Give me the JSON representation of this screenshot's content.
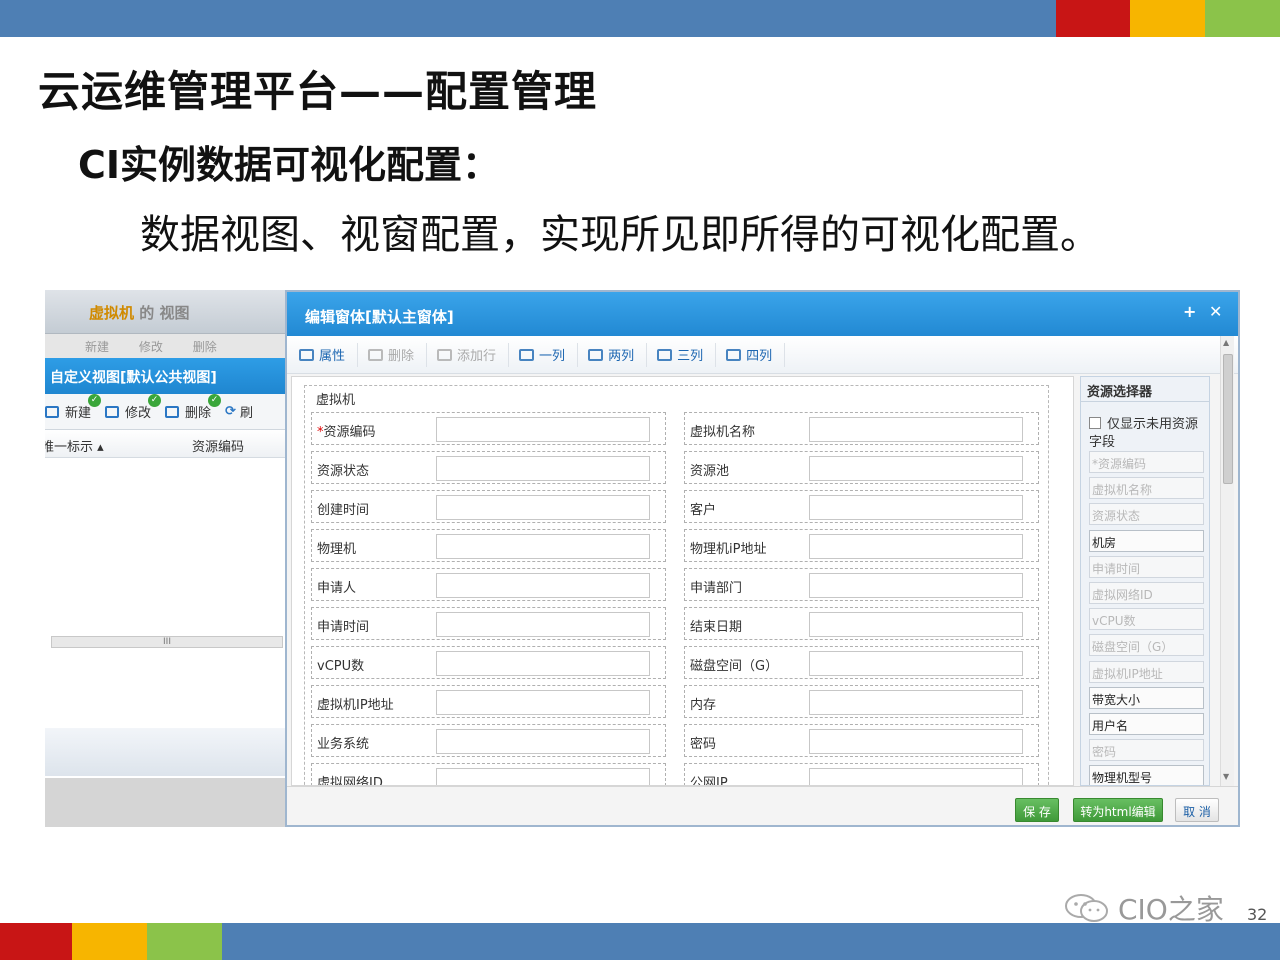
{
  "slide": {
    "title": "云运维管理平台——配置管理",
    "subtitle": "CI实例数据可视化配置：",
    "description": "数据视图、视窗配置，实现所见即所得的可视化配置。",
    "page_number": "32",
    "logo_text": "CIO之家",
    "colors": {
      "blue": "#4e7fb4",
      "red": "#c81515",
      "yellow": "#f7b500",
      "green": "#8bc34a"
    }
  },
  "bg_app": {
    "header_highlight": "虚拟机",
    "header_rest": " 的 视图",
    "toolbar": [
      "新建",
      "修改",
      "删除"
    ],
    "view_panel": {
      "title": "自定义视图[默认公共视图]",
      "toolbar": [
        {
          "label": "新建",
          "icon": "folder-icon"
        },
        {
          "label": "修改",
          "icon": "edit-icon"
        },
        {
          "label": "删除",
          "icon": "trash-icon"
        },
        {
          "label": "刷",
          "icon": "refresh-icon"
        }
      ],
      "columns": [
        "唯一标示 ▴",
        "资源编码"
      ],
      "scroll_text": "III"
    }
  },
  "dialog": {
    "title": "编辑窗体[默认主窗体]",
    "toolbar": [
      {
        "label": "属性",
        "state": "active",
        "icon": "property-icon"
      },
      {
        "label": "删除",
        "state": "disabled",
        "icon": "delete-icon"
      },
      {
        "label": "添加行",
        "state": "disabled",
        "icon": "add-row-icon"
      },
      {
        "label": "一列",
        "state": "col",
        "icon": "one-column-icon"
      },
      {
        "label": "两列",
        "state": "col",
        "icon": "two-column-icon"
      },
      {
        "label": "三列",
        "state": "col",
        "icon": "three-column-icon"
      },
      {
        "label": "四列",
        "state": "col",
        "icon": "four-column-icon"
      }
    ],
    "form_group_title": "虚拟机",
    "fields": [
      [
        "资源编码",
        "虚拟机名称"
      ],
      [
        "资源状态",
        "资源池"
      ],
      [
        "创建时间",
        "客户"
      ],
      [
        "物理机",
        "物理机iP地址"
      ],
      [
        "申请人",
        "申请部门"
      ],
      [
        "申请时间",
        "结束日期"
      ],
      [
        "vCPU数",
        "磁盘空间（G）"
      ],
      [
        "虚拟机IP地址",
        "内存"
      ],
      [
        "业务系统",
        "密码"
      ],
      [
        "虚拟网络ID",
        "公网IP"
      ]
    ],
    "required_marker": "*",
    "resource_selector": {
      "title": "资源选择器",
      "checkbox_label": "仅显示未用资源",
      "fields_label": "字段",
      "items": [
        {
          "label": "*资源编码",
          "used": true
        },
        {
          "label": "虚拟机名称",
          "used": true
        },
        {
          "label": "资源状态",
          "used": true
        },
        {
          "label": "机房",
          "used": false
        },
        {
          "label": "申请时间",
          "used": true
        },
        {
          "label": "虚拟网络ID",
          "used": true
        },
        {
          "label": "vCPU数",
          "used": true
        },
        {
          "label": "磁盘空间（G）",
          "used": true
        },
        {
          "label": "虚拟机IP地址",
          "used": true
        },
        {
          "label": "带宽大小",
          "used": false
        },
        {
          "label": "用户名",
          "used": false
        },
        {
          "label": "密码",
          "used": true
        },
        {
          "label": "物理机型号",
          "used": false
        }
      ]
    },
    "footer": {
      "save": "保 存",
      "to_html": "转为html编辑",
      "cancel": "取 消"
    }
  }
}
